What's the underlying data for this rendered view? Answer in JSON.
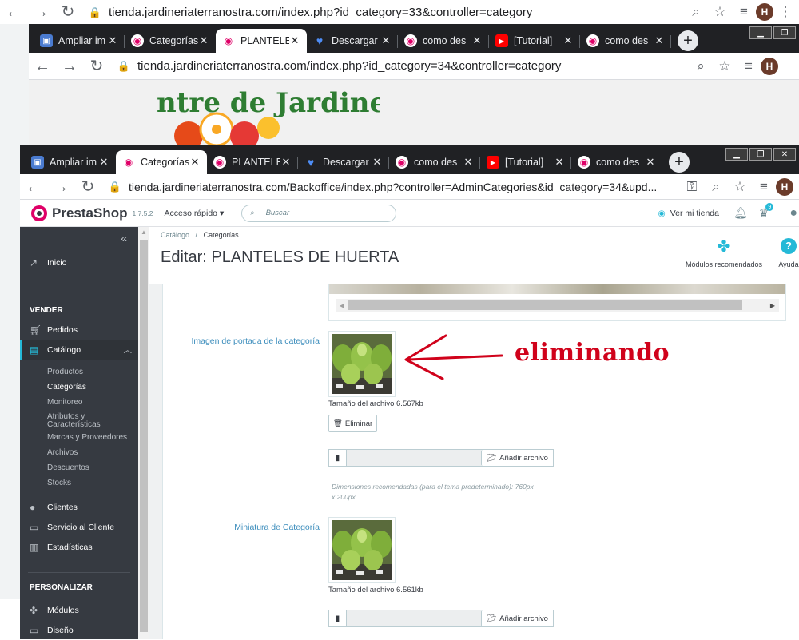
{
  "outer_browser": {
    "url": "tienda.jardineriaterranostra.com/index.php?id_category=33&controller=category",
    "avatar": "H"
  },
  "mid_browser": {
    "tabs": [
      {
        "title": "Ampliar im",
        "favicon": "gallery-icon"
      },
      {
        "title": "Categorías",
        "favicon": "prestashop-icon"
      },
      {
        "title": "PLANTELES",
        "favicon": "prestashop-icon",
        "active": true
      },
      {
        "title": "Descargar",
        "favicon": "heart-icon"
      },
      {
        "title": "como des",
        "favicon": "prestashop-icon"
      },
      {
        "title": "[Tutorial]",
        "favicon": "youtube-icon"
      },
      {
        "title": "como des",
        "favicon": "prestashop-icon"
      }
    ],
    "url": "tienda.jardineriaterranostra.com/index.php?id_category=34&controller=category",
    "avatar": "H"
  },
  "inner_browser": {
    "tabs": [
      {
        "title": "Ampliar im",
        "favicon": "gallery-icon"
      },
      {
        "title": "Categorías",
        "favicon": "prestashop-icon",
        "active": true
      },
      {
        "title": "PLANTELES",
        "favicon": "prestashop-icon"
      },
      {
        "title": "Descargar",
        "favicon": "heart-icon"
      },
      {
        "title": "como des",
        "favicon": "prestashop-icon"
      },
      {
        "title": "[Tutorial]",
        "favicon": "youtube-icon"
      },
      {
        "title": "como des",
        "favicon": "prestashop-icon"
      }
    ],
    "url": "tienda.jardineriaterranostra.com/Backoffice/index.php?controller=AdminCategories&id_category=34&upd...",
    "avatar": "H"
  },
  "header": {
    "brand": "PrestaShop",
    "version": "1.7.5.2",
    "quick_access": "Acceso rápido",
    "search_placeholder": "Buscar",
    "view_store": "Ver mi tienda",
    "notif_count": "9"
  },
  "sidebar": {
    "home": "Inicio",
    "sell_section": "VENDER",
    "orders": "Pedidos",
    "catalog": "Catálogo",
    "catalog_items": [
      "Productos",
      "Categorías",
      "Monitoreo",
      "Atributos y",
      "Características",
      "Marcas y Proveedores",
      "Archivos",
      "Descuentos",
      "Stocks"
    ],
    "clients": "Clientes",
    "customer_service": "Servicio al Cliente",
    "stats": "Estadísticas",
    "customize_section": "PERSONALIZAR",
    "modules": "Módulos",
    "design": "Diseño"
  },
  "page": {
    "breadcrumb_1": "Catálogo",
    "breadcrumb_sep": "/",
    "breadcrumb_2": "Categorías",
    "title": "Editar: PLANTELES DE HUERTA",
    "recommended_modules": "Módulos recomendados",
    "help": "Ayuda"
  },
  "form": {
    "cover_label": "Imagen de portada de la categoría",
    "cover_size": "Tamaño del archivo 6.567kb",
    "delete_btn": "Eliminar",
    "add_file": "Añadir archivo",
    "dimensions_1": "Dimensiones recomendadas (para el tema predeterminado): 760px",
    "dimensions_2": "x 200px",
    "thumb_label": "Miniatura de Categoría",
    "thumb_size": "Tamaño del archivo 6.561kb",
    "add_file_2": "Añadir archivo"
  },
  "annotation": {
    "text": "eliminando",
    "color": "#d0021b"
  }
}
